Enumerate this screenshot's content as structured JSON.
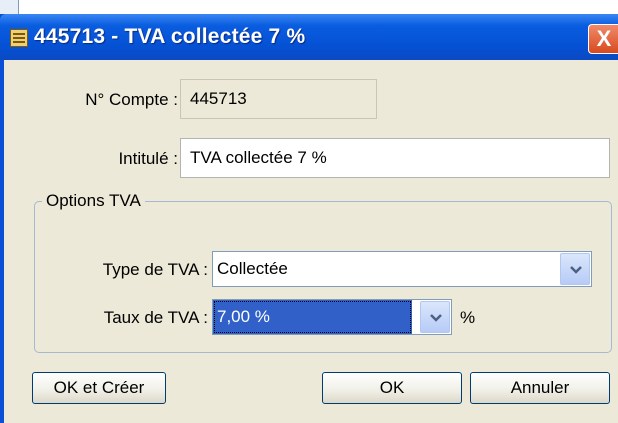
{
  "window": {
    "title": "445713 - TVA collectée 7 %",
    "close_label": "X"
  },
  "account": {
    "number_label": "N° Compte :",
    "number_value": "445713",
    "title_label": "Intitulé :",
    "title_value": "TVA collectée 7 %"
  },
  "tva_options": {
    "group_label": "Options TVA",
    "type_label": "Type de TVA :",
    "type_value": "Collectée",
    "rate_label": "Taux de TVA :",
    "rate_value": "7,00 %",
    "rate_unit": "%"
  },
  "buttons": {
    "ok_create": "OK et Créer",
    "ok": "OK",
    "cancel": "Annuler"
  },
  "icons": {
    "window_icon": "ledger-icon",
    "dropdown_arrow": "chevron-down-icon"
  },
  "colors": {
    "titlebar": "#0a5de0",
    "selection": "#3161c8",
    "dialog_bg": "#ece9d8"
  }
}
